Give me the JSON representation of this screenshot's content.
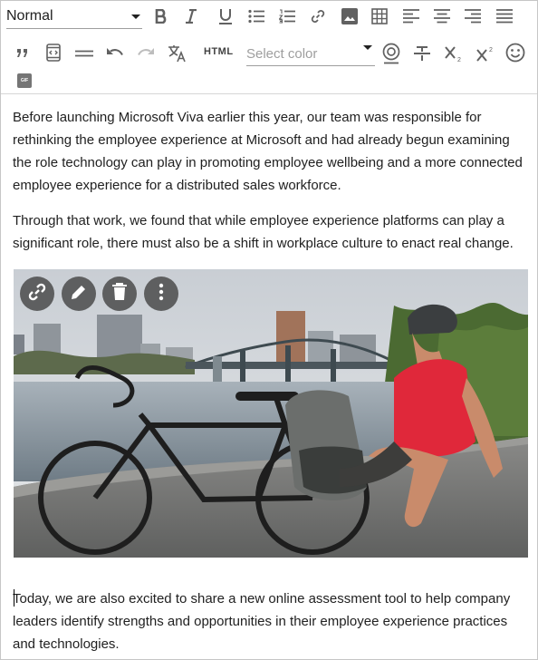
{
  "toolbar": {
    "format_value": "Normal",
    "html_label": "HTML",
    "color_placeholder": "Select color",
    "gif_label": "GIF"
  },
  "icons": {
    "row1": [
      "bold-icon",
      "italic-icon",
      "underline-icon",
      "bulleted-list-icon",
      "numbered-list-icon",
      "link-icon",
      "image-icon",
      "table-icon",
      "align-left-icon",
      "align-center-icon",
      "align-right-icon",
      "align-justify-icon"
    ],
    "row2": [
      "blockquote-icon",
      "code-view-icon",
      "horizontal-rule-icon",
      "undo-icon",
      "redo-icon",
      "translate-icon",
      "html-button",
      "color-select",
      "emoticon-mention-icon",
      "strikethrough-icon",
      "subscript-icon",
      "superscript-icon",
      "emoji-icon"
    ],
    "image_overlay": [
      "link-icon",
      "edit-icon",
      "delete-icon",
      "more-vertical-icon"
    ]
  },
  "content": {
    "p1": "Before launching Microsoft Viva earlier this year, our team was responsible for rethinking the employee experience at Microsoft and had already begun examining the role technology can play in promoting employee wellbeing and a more connected employee experience for a distributed sales workforce.",
    "p2": "Through that work, we found that while employee experience platforms can play a significant role, there must also be a shift in workplace culture to enact real change.",
    "p3": "Today, we are also excited to share a new online assessment tool to help company leaders identify strengths and opportunities in their employee experience practices and technologies."
  },
  "colors": {
    "icon": "#616161",
    "overlay_button": "#464646",
    "shirt": "#e0283a",
    "bike_frame": "#1e1e1e",
    "sky": "#d8dde3",
    "river": "#8e9aa4"
  }
}
